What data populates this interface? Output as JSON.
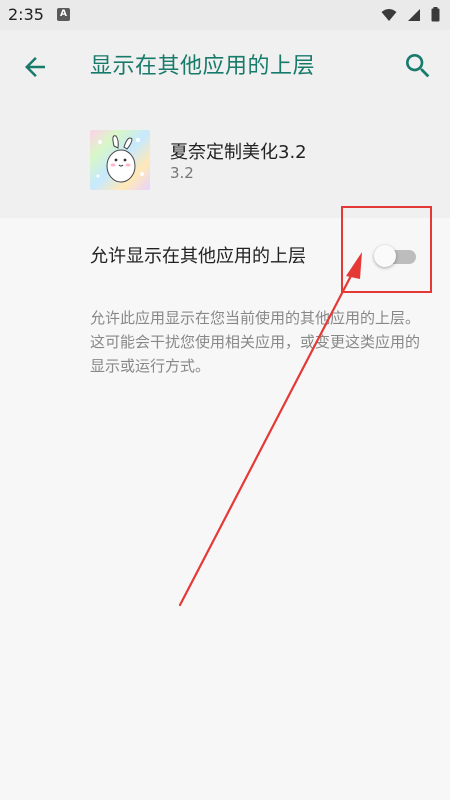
{
  "status_bar": {
    "time": "2:35",
    "notification_icon": "a-icon",
    "icons": [
      "wifi-icon",
      "signal-icon",
      "battery-icon"
    ]
  },
  "app_bar": {
    "title": "显示在其他应用的上层",
    "back_icon": "arrow-back-icon",
    "search_icon": "search-icon",
    "accent_color": "#187a6a"
  },
  "app_header": {
    "app_name": "夏奈定制美化3.2",
    "version": "3.2"
  },
  "permission": {
    "label": "允许显示在其他应用的上层",
    "toggle_on": false,
    "description": "允许此应用显示在您当前使用的其他应用的上层。这可能会干扰您使用相关应用，或变更这类应用的显示或运行方式。"
  },
  "annotation": {
    "highlight_color": "#e53935"
  }
}
